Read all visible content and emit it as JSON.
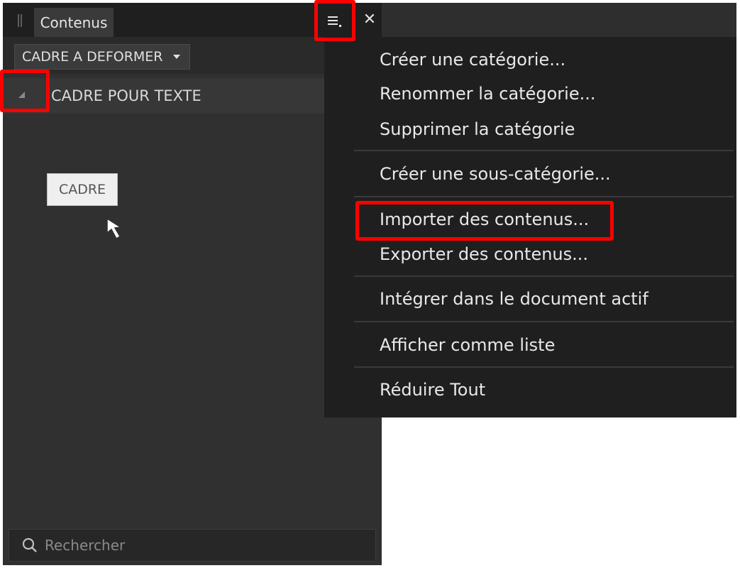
{
  "panel": {
    "tab_label": "Contenus",
    "dropdown_value": "CADRE A DEFORMER",
    "category_label": "CADRE POUR TEXTE",
    "item_label": "CADRE",
    "search_placeholder": "Rechercher"
  },
  "menu": {
    "items": [
      {
        "label": "Créer une catégorie..."
      },
      {
        "label": "Renommer la catégorie..."
      },
      {
        "label": "Supprimer la catégorie"
      },
      {
        "label": "Créer une sous-catégorie..."
      },
      {
        "label": "Importer des contenus..."
      },
      {
        "label": "Exporter des contenus..."
      },
      {
        "label": "Intégrer dans le document actif"
      },
      {
        "label": "Afficher comme liste"
      },
      {
        "label": "Réduire Tout"
      }
    ]
  },
  "icons": {
    "menu": "hamburger-menu-icon",
    "close": "close-icon",
    "search": "search-icon",
    "expander": "triangle-expander-icon",
    "cursor": "mouse-cursor-icon"
  },
  "colors": {
    "highlight": "#ff0000",
    "panel_bg": "#303030",
    "menu_bg": "#1f1f1f"
  }
}
